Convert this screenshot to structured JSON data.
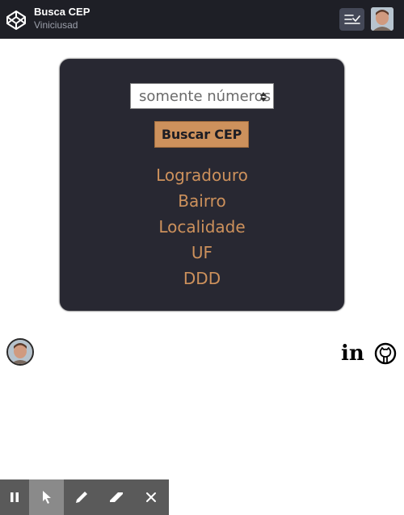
{
  "header": {
    "title": "Busca CEP",
    "author": "Viniciusad"
  },
  "form": {
    "cep_placeholder": "somente números",
    "search_label": "Buscar CEP"
  },
  "results": [
    "Logradouro",
    "Bairro",
    "Localidade",
    "UF",
    "DDD"
  ],
  "footer": {
    "linkedin_label": "in"
  },
  "colors": {
    "topbar": "#1e1f26",
    "card": "#282832",
    "accent": "#cd915c",
    "toolbar": "#5a5a5a"
  },
  "icons": {
    "logo": "codepen-icon",
    "view": "change-view-icon",
    "linkedin": "linkedin-icon",
    "github": "github-icon",
    "toolbar": [
      "pause-icon",
      "cursor-icon",
      "pen-icon",
      "eraser-icon",
      "close-icon"
    ]
  }
}
